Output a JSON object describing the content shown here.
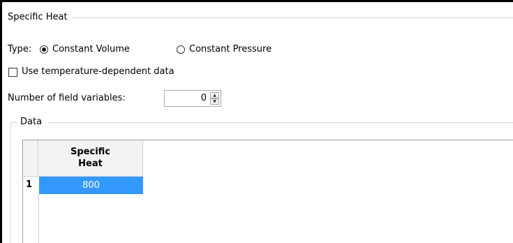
{
  "specific_heat_group": {
    "title": "Specific Heat"
  },
  "type_row": {
    "label": "Type:",
    "options": [
      {
        "label": "Constant Volume",
        "selected": true
      },
      {
        "label": "Constant Pressure",
        "selected": false
      }
    ]
  },
  "temperature_dependent": {
    "label": "Use temperature-dependent data",
    "checked": false
  },
  "field_variables": {
    "label": "Number of field variables:",
    "value": "0"
  },
  "data_group": {
    "title": "Data",
    "table": {
      "header_line1": "Specific",
      "header_line2": "Heat",
      "rows": [
        {
          "index": "1",
          "value": "800"
        }
      ]
    }
  },
  "colors": {
    "selection": "#3399ff",
    "header_bg": "#f3f3f3"
  }
}
